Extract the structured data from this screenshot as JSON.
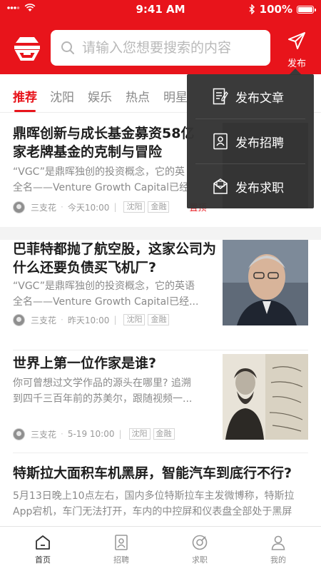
{
  "status_bar": {
    "time": "9:41 AM",
    "battery": "100%"
  },
  "header": {
    "search_placeholder": "请输入您想要搜索的内容",
    "publish_label": "发布",
    "colors": {
      "brand": "#e8141b"
    }
  },
  "tabs": [
    {
      "label": "推荐",
      "active": true
    },
    {
      "label": "沈阳",
      "active": false
    },
    {
      "label": "娱乐",
      "active": false
    },
    {
      "label": "热点",
      "active": false
    },
    {
      "label": "明星",
      "active": false
    }
  ],
  "articles": [
    {
      "title": "鼎晖创新与成长基金募资58亿 家老牌基金的克制与冒险",
      "title_line1": "鼎晖创新与成长基金募资58亿",
      "title_line2": "家老牌基金的克制与冒险",
      "desc_line1": "“VGC”是鼎晖独创的投资概念，它的英",
      "desc_line2": "全名——Venture Growth Capital已经",
      "author": "三支花",
      "time": "今天10:00",
      "tags": [
        "沈阳",
        "金融"
      ],
      "badge": "置顶"
    },
    {
      "title_line1": "巴菲特都抛了航空股，这家公司为",
      "title_line2": "什么还要负债买飞机厂?",
      "desc_line1": "“VGC”是鼎晖独创的投资概念，它的英语",
      "desc_line2": "全名——Venture Growth Capital已经...",
      "author": "三支花",
      "time": "昨天10:00",
      "tags": [
        "沈阳",
        "金融"
      ]
    },
    {
      "title_line1": "世界上第一位作家是谁?",
      "desc_line1": "你可曾想过文学作品的源头在哪里? 追溯",
      "desc_line2": "到四千三百年前的苏美尔，跟随视频一...",
      "author": "三支花",
      "time": "5-19 10:00",
      "tags": [
        "沈阳",
        "金融"
      ]
    },
    {
      "title_line1": "特斯拉大面积车机黑屏，智能汽车到底行不行?",
      "desc_line1": "5月13日晚上10点左右，国内多位特斯拉车主发微博称，特斯拉",
      "desc_line2": "App宕机，车门无法打开，车内的中控屏和仪表盘全部处于黑屏"
    }
  ],
  "publish_menu": [
    {
      "label": "发布文章",
      "icon": "article-icon"
    },
    {
      "label": "发布招聘",
      "icon": "recruit-icon"
    },
    {
      "label": "发布求职",
      "icon": "job-seek-icon"
    }
  ],
  "bottom_nav": [
    {
      "label": "首页",
      "icon": "home-icon",
      "active": true
    },
    {
      "label": "招聘",
      "icon": "recruit-icon",
      "active": false
    },
    {
      "label": "求职",
      "icon": "job-seek-icon",
      "active": false
    },
    {
      "label": "我的",
      "icon": "profile-icon",
      "active": false
    }
  ]
}
